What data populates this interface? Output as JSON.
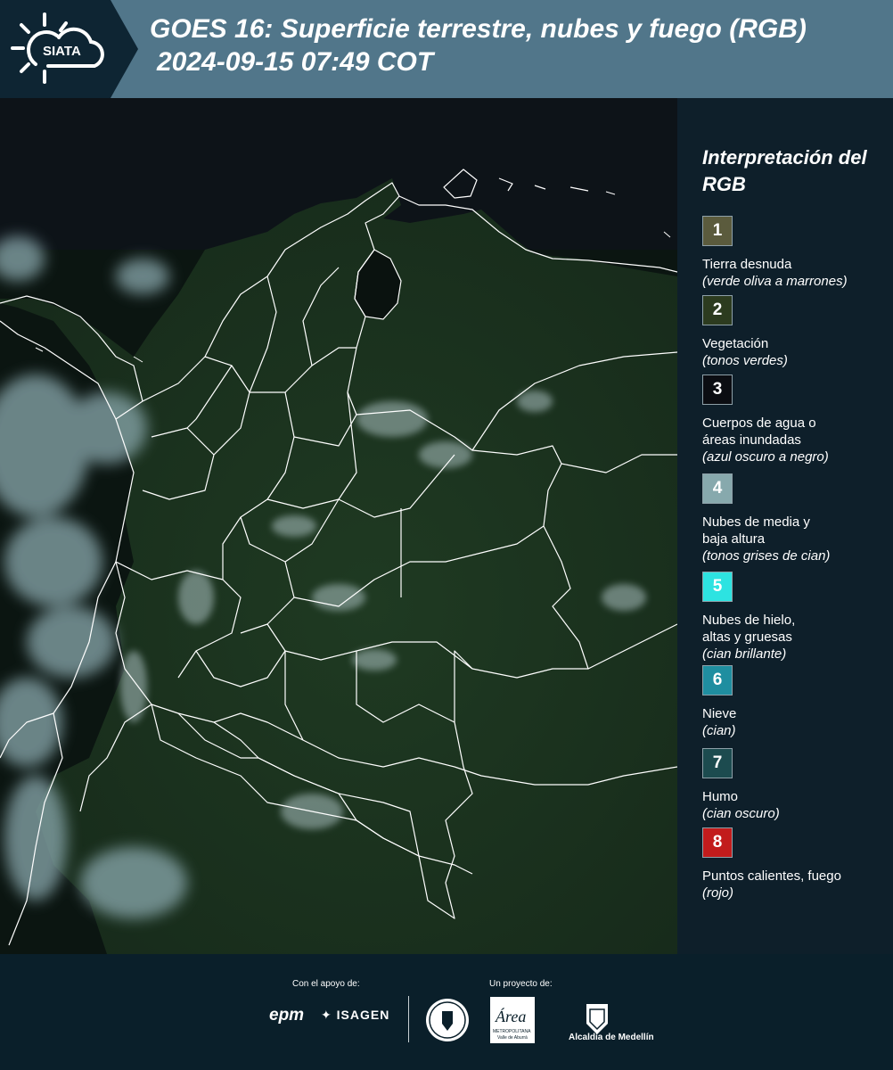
{
  "header": {
    "logo_text": "SIATA",
    "title_line1": "GOES 16: Superficie terrestre, nubes y fuego (RGB)",
    "title_line2": "2024-09-15 07:49 COT"
  },
  "legend": {
    "title": "Interpretación del RGB",
    "items": [
      {
        "number": "1",
        "name": "Tierra desnuda",
        "desc": "(verde oliva a marrones)",
        "color": "#5b5b3d"
      },
      {
        "number": "2",
        "name": "Vegetación",
        "desc": "(tonos verdes)",
        "color": "#2c3b1f"
      },
      {
        "number": "3",
        "name": "Cuerpos de agua o\náreas inundadas",
        "desc": "(azul oscuro a negro)",
        "color": "#0b0d12"
      },
      {
        "number": "4",
        "name": "Nubes de media y\nbaja altura",
        "desc": "(tonos grises de cian)",
        "color": "#87a9ad"
      },
      {
        "number": "5",
        "name": "Nubes de hielo,\naltas y gruesas",
        "desc": "(cian brillante)",
        "color": "#2de3e1"
      },
      {
        "number": "6",
        "name": "Nieve",
        "desc": "(cian)",
        "color": "#1f8ea0"
      },
      {
        "number": "7",
        "name": "Humo",
        "desc": "(cian oscuro)",
        "color": "#1c4b4f"
      },
      {
        "number": "8",
        "name": "Puntos calientes, fuego",
        "desc": "(rojo)",
        "color": "#c21c1c"
      }
    ]
  },
  "footer": {
    "support_label": "Con el apoyo de:",
    "project_label": "Un proyecto de:",
    "epm": "epm",
    "isagen": "ISAGEN",
    "area_main": "Área",
    "area_sub": "METROPOLITANA",
    "area_sub2": "Valle de Aburrá",
    "alcaldia": "Alcaldía de Medellín"
  },
  "map": {
    "colors": {
      "land": "#1d3320",
      "water": "#0b1511",
      "cloud": "#8aa9ae",
      "border": "#ffffff"
    }
  }
}
